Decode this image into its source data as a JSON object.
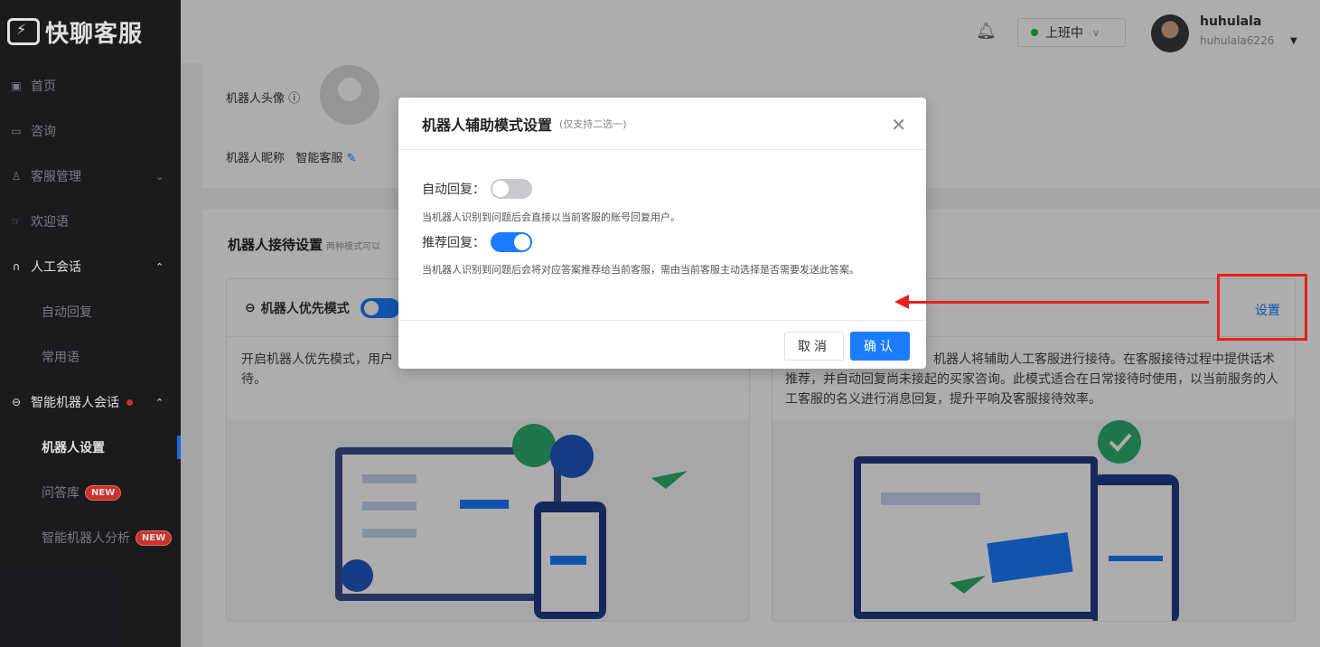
{
  "app": {
    "logo_text": "快聊客服"
  },
  "sidebar": {
    "items": [
      {
        "label": "首页"
      },
      {
        "label": "咨询"
      },
      {
        "label": "客服管理"
      },
      {
        "label": "欢迎语"
      },
      {
        "label": "人工会话"
      },
      {
        "label": "自动回复"
      },
      {
        "label": "常用语"
      },
      {
        "label": "智能机器人会话"
      },
      {
        "label": "机器人设置"
      },
      {
        "label": "问答库",
        "badge": "NEW"
      },
      {
        "label": "智能机器人分析",
        "badge": "NEW"
      }
    ]
  },
  "header": {
    "status": "上班中",
    "user_name": "huhulala",
    "user_id": "huhulala6226"
  },
  "profile": {
    "avatar_label": "机器人头像",
    "nickname_label": "机器人昵称",
    "nickname_value": "智能客服"
  },
  "reception": {
    "title": "机器人接待设置",
    "subtitle": "两种模式可以",
    "priority_mode": {
      "label": "机器人优先模式",
      "desc": "开启机器人优先模式，用户",
      "desc_tail": "待。"
    },
    "assist_mode": {
      "desc": "机器人将辅助人工客服进行接待。在客服接待过程中提供话术推荐，并自动回复尚未接起的买家咨询。此模式适合在日常接待时使用，以当前服务的人工客服的名义进行消息回复，提升平响及客服接待效率。",
      "settings_link": "设置"
    }
  },
  "modal": {
    "title": "机器人辅助模式设置",
    "subtitle": "(仅支持二选一)",
    "auto_reply_label": "自动回复：",
    "auto_reply_desc": "当机器人识别到问题后会直接以当前客服的账号回复用户。",
    "recommend_label": "推荐回复：",
    "recommend_desc": "当机器人识别到问题后会将对应答案推荐给当前客服，需由当前客服主动选择是否需要发送此答案。",
    "cancel_label": "取消",
    "confirm_label": "确认"
  },
  "colors": {
    "accent": "#1a7cff",
    "annotation": "#e8201a",
    "online": "#1fba4c"
  }
}
